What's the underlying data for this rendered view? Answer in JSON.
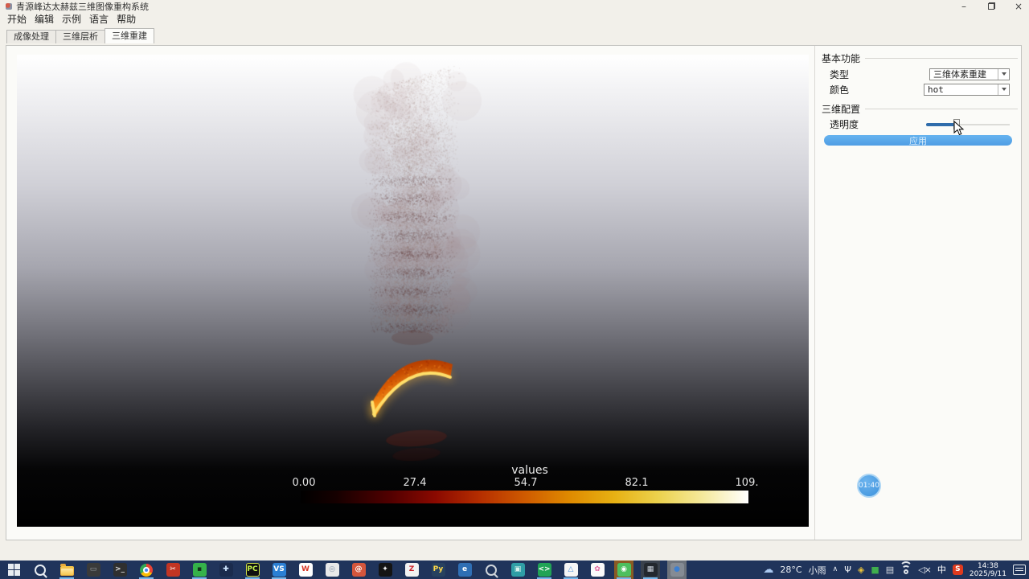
{
  "window": {
    "title": "青源峰达太赫兹三维图像重构系统",
    "minimize": "–",
    "close": "×"
  },
  "menu": {
    "items": [
      "开始",
      "编辑",
      "示例",
      "语言",
      "帮助"
    ]
  },
  "tabs": {
    "items": [
      {
        "label": "成像处理"
      },
      {
        "label": "三维层析"
      },
      {
        "label": "三维重建"
      }
    ]
  },
  "panel": {
    "basic_group": "基本功能",
    "type_label": "类型",
    "type_value": "三维体素重建",
    "color_label": "颜色",
    "color_value": "hot",
    "config_group": "三维配置",
    "opacity_label": "透明度",
    "opacity_percent": 36,
    "apply_label": "应用",
    "accent_color": "#55a8ec"
  },
  "viewport": {
    "colorbar": {
      "title": "values",
      "colormap": "hot",
      "ticks": [
        "0.00",
        "27.4",
        "54.7",
        "82.1",
        "109."
      ]
    }
  },
  "recorder": {
    "time": "01:40"
  },
  "taskbar": {
    "icons": [
      {
        "name": "start",
        "kind": "win"
      },
      {
        "name": "search",
        "kind": "search",
        "fg": "#e8edf2"
      },
      {
        "name": "file-explorer",
        "kind": "folder",
        "underline": true
      },
      {
        "name": "console-window",
        "kind": "glyph",
        "glyph": "▭",
        "fg": "#9aa0a6",
        "bg": "#3a3a3a"
      },
      {
        "name": "terminal",
        "kind": "glyph",
        "glyph": ">_",
        "fg": "#dddddd",
        "bg": "#2f2f2f"
      },
      {
        "name": "chrome",
        "kind": "chrome",
        "underline": true
      },
      {
        "name": "clip-tool",
        "kind": "glyph",
        "glyph": "✂",
        "fg": "#ffffff",
        "bg": "#c23524"
      },
      {
        "name": "green-app",
        "kind": "glyph",
        "glyph": "▪",
        "fg": "#14331a",
        "bg": "#35b24a",
        "underline": true
      },
      {
        "name": "tim",
        "kind": "glyph",
        "glyph": "✚",
        "fg": "#cfe6ff",
        "bg": "#1b2b4d"
      },
      {
        "name": "pycharm",
        "kind": "glyph",
        "glyph": "PC",
        "fg": "#c3f34c",
        "bg": "#101010",
        "border": "#d3e44a",
        "underline": true
      },
      {
        "name": "vscode",
        "kind": "glyph",
        "glyph": "VS",
        "fg": "#ffffff",
        "bg": "#2b7fd4",
        "underline": true
      },
      {
        "name": "wps",
        "kind": "glyph",
        "glyph": "W",
        "fg": "#d93a2b",
        "bg": "#ffffff"
      },
      {
        "name": "disc-app",
        "kind": "glyph",
        "glyph": "◎",
        "fg": "#8896a8",
        "bg": "#e9e9e9"
      },
      {
        "name": "snail-app",
        "kind": "glyph",
        "glyph": "@",
        "fg": "#ffffff",
        "bg": "#d4563c"
      },
      {
        "name": "dark-bird-app",
        "kind": "glyph",
        "glyph": "✦",
        "fg": "#eeeeee",
        "bg": "#141414"
      },
      {
        "name": "z-app",
        "kind": "glyph",
        "glyph": "Z",
        "fg": "#cc2229",
        "bg": "#f2f2f2"
      },
      {
        "name": "python",
        "kind": "glyph",
        "glyph": "Py",
        "fg": "#ffd94a",
        "bg": "#27415f"
      },
      {
        "name": "edge",
        "kind": "glyph",
        "glyph": "e",
        "fg": "#ffffff",
        "bg": "#2f6fb5"
      },
      {
        "name": "magnifier-tool",
        "kind": "search",
        "fg": "#cfd4da"
      },
      {
        "name": "image-viewer",
        "kind": "glyph",
        "glyph": "▣",
        "fg": "#d8f2ee",
        "bg": "#2f9ea6"
      },
      {
        "name": "wechat-devtools",
        "kind": "glyph",
        "glyph": "<>",
        "fg": "#ffffff",
        "bg": "#21a356",
        "underline": true
      },
      {
        "name": "netview",
        "kind": "glyph",
        "glyph": "△",
        "fg": "#4a90d9",
        "bg": "#f5f5f5",
        "underline": true
      },
      {
        "name": "flower-app",
        "kind": "glyph",
        "glyph": "✿",
        "fg": "#e464a0",
        "bg": "#fafafa"
      },
      {
        "name": "wechat",
        "kind": "glyph",
        "glyph": "◉",
        "fg": "#ffffff",
        "bg": "#4dbf5e",
        "slot": "#8a5a24",
        "underline": true
      },
      {
        "name": "app-grid",
        "kind": "glyph",
        "glyph": "▦",
        "fg": "#cfd6df",
        "bg": "#23282e",
        "slot": "#39414c",
        "underline": true
      },
      {
        "name": "globe-app",
        "kind": "glyph",
        "glyph": "●",
        "fg": "#3d7fd0",
        "bg": "#858b94",
        "slot": "#6d737c"
      }
    ],
    "tray": {
      "cloud": "☁",
      "weather_temp": "28°C",
      "weather_desc": "小雨",
      "caret": "∧",
      "mic": "Ψ",
      "shield": "◈",
      "green_square": "■",
      "printer": "▤",
      "volume_muted": "◁×",
      "ime": "中",
      "sogou": "S",
      "time": "14:38",
      "date": "2025/9/11"
    }
  }
}
